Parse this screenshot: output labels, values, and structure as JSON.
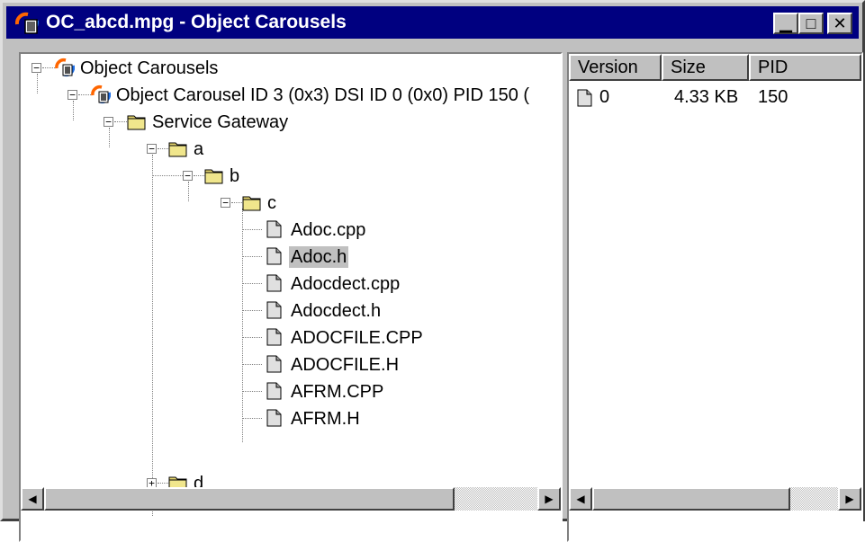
{
  "window": {
    "title": "OC_abcd.mpg - Object Carousels",
    "minimize_glyph": "▁",
    "maximize_glyph": "□",
    "close_glyph": "✕"
  },
  "tree": {
    "root": "Object Carousels",
    "carousel": "Object Carousel ID 3 (0x3) DSI ID 0 (0x0) PID 150 (",
    "gateway": "Service Gateway",
    "folder_a": "a",
    "folder_b": "b",
    "folder_c": "c",
    "files": [
      "Adoc.cpp",
      "Adoc.h",
      "Adocdect.cpp",
      "Adocdect.h",
      "ADOCFILE.CPP",
      "ADOCFILE.H",
      "AFRM.CPP",
      "AFRM.H"
    ],
    "selected_file": "Adoc.h",
    "folder_d": "d"
  },
  "list": {
    "columns": [
      "Version",
      "Size",
      "PID"
    ],
    "rows": [
      {
        "version": "0",
        "size": "4.33 KB",
        "pid": "150"
      }
    ]
  },
  "icons": {
    "app": "object-carousel-icon",
    "carousel": "object-carousel-icon",
    "folder": "folder-icon",
    "file": "file-icon",
    "expand": "plus-box-icon",
    "collapse": "minus-box-icon"
  }
}
